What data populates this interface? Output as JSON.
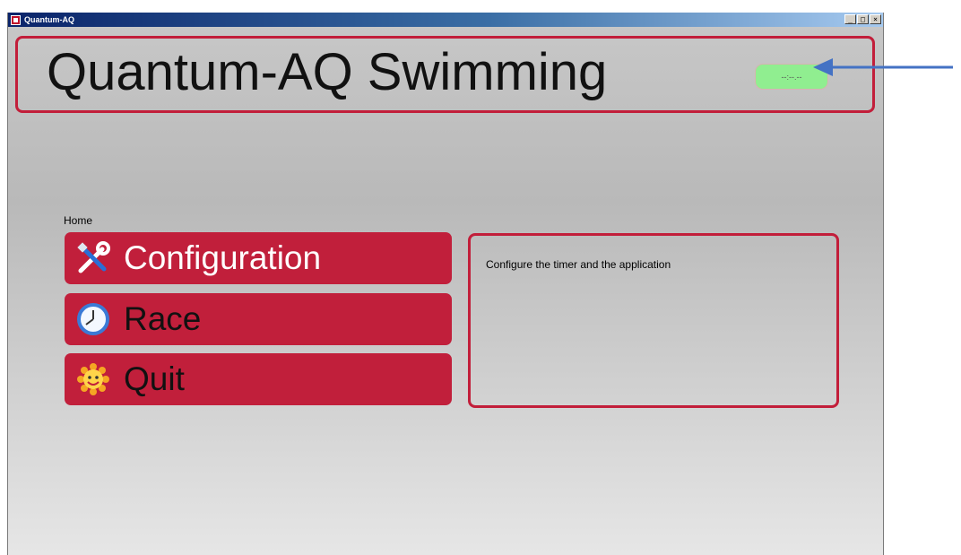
{
  "window": {
    "title": "Quantum-AQ",
    "buttons": {
      "minimize": "_",
      "maximize": "□",
      "close": "×"
    }
  },
  "header": {
    "app_title": "Quantum-AQ Swimming",
    "timer": "--:--.--"
  },
  "breadcrumb": "Home",
  "menu": {
    "items": [
      {
        "label": "Configuration",
        "icon": "tools-icon"
      },
      {
        "label": "Race",
        "icon": "clock-icon"
      },
      {
        "label": "Quit",
        "icon": "sun-icon"
      }
    ]
  },
  "description": "Configure the timer and the application",
  "colors": {
    "accent": "#c11f3b",
    "timer_bg": "#90ee90",
    "annotation_arrow": "#4472c4"
  }
}
